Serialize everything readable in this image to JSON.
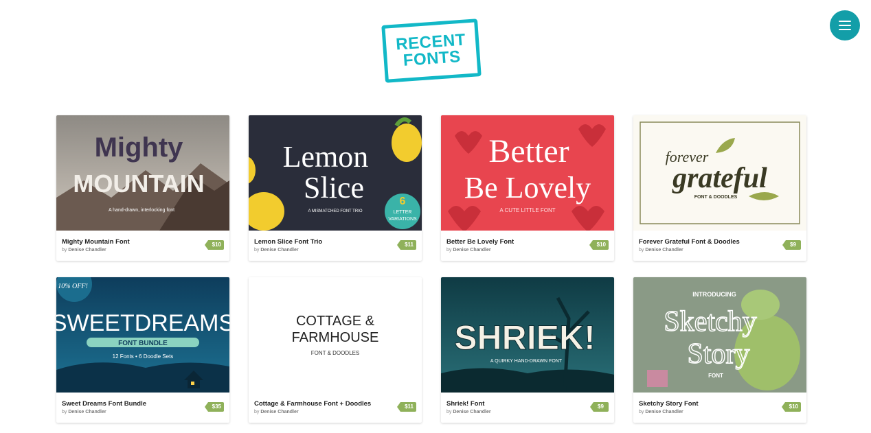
{
  "logo": {
    "line1": "RECENT",
    "line2": "FONTS"
  },
  "products": [
    {
      "title": "Mighty Mountain Font",
      "by": "by",
      "author": "Denise Chandler",
      "price": "$10",
      "art": {
        "line1": "Mighty",
        "line2": "MOUNTAIN",
        "tagline": "A hand-drawn, interlocking font"
      }
    },
    {
      "title": "Lemon Slice Font Trio",
      "by": "by",
      "author": "Denise Chandler",
      "price": "$11",
      "art": {
        "line1": "Lemon",
        "line2": "Slice",
        "tagline": "A MISMATCHED FONT TRIO",
        "badge_line1": "6",
        "badge_line2": "LETTER",
        "badge_line3": "VARIATIONS"
      }
    },
    {
      "title": "Better Be Lovely Font",
      "by": "by",
      "author": "Denise Chandler",
      "price": "$10",
      "art": {
        "line1": "Better",
        "line2": "Be Lovely",
        "tagline": "A CUTE LITTLE FONT"
      }
    },
    {
      "title": "Forever Grateful Font & Doodles",
      "by": "by",
      "author": "Denise Chandler",
      "price": "$9",
      "art": {
        "line1": "forever",
        "line2": "grateful",
        "tagline": "FONT & DOODLES"
      }
    },
    {
      "title": "Sweet Dreams Font Bundle",
      "by": "by",
      "author": "Denise Chandler",
      "price": "$35",
      "art": {
        "badge": "10% OFF!",
        "line1": "SWEETDREAMS",
        "line2": "FONT BUNDLE",
        "tagline": "12 Fonts • 6 Doodle Sets"
      }
    },
    {
      "title": "Cottage & Farmhouse Font + Doodles",
      "by": "by",
      "author": "Denise Chandler",
      "price": "$11",
      "art": {
        "line1": "COTTAGE &",
        "line2": "FARMHOUSE",
        "tagline": "FONT & DOODLES"
      }
    },
    {
      "title": "Shriek! Font",
      "by": "by",
      "author": "Denise Chandler",
      "price": "$9",
      "art": {
        "line1": "SHRIEK!",
        "tagline": "A QUIRKY HAND-DRAWN FONT"
      }
    },
    {
      "title": "Sketchy Story Font",
      "by": "by",
      "author": "Denise Chandler",
      "price": "$10",
      "art": {
        "line0": "INTRODUCING",
        "line1": "Sketchy",
        "line2": "Story",
        "tagline": "FONT"
      }
    }
  ],
  "colors": {
    "brand": "#12b8c7",
    "menu": "#139ea8",
    "price_tag": "#8fb15a"
  },
  "icons": {
    "menu": "hamburger-menu-icon"
  }
}
